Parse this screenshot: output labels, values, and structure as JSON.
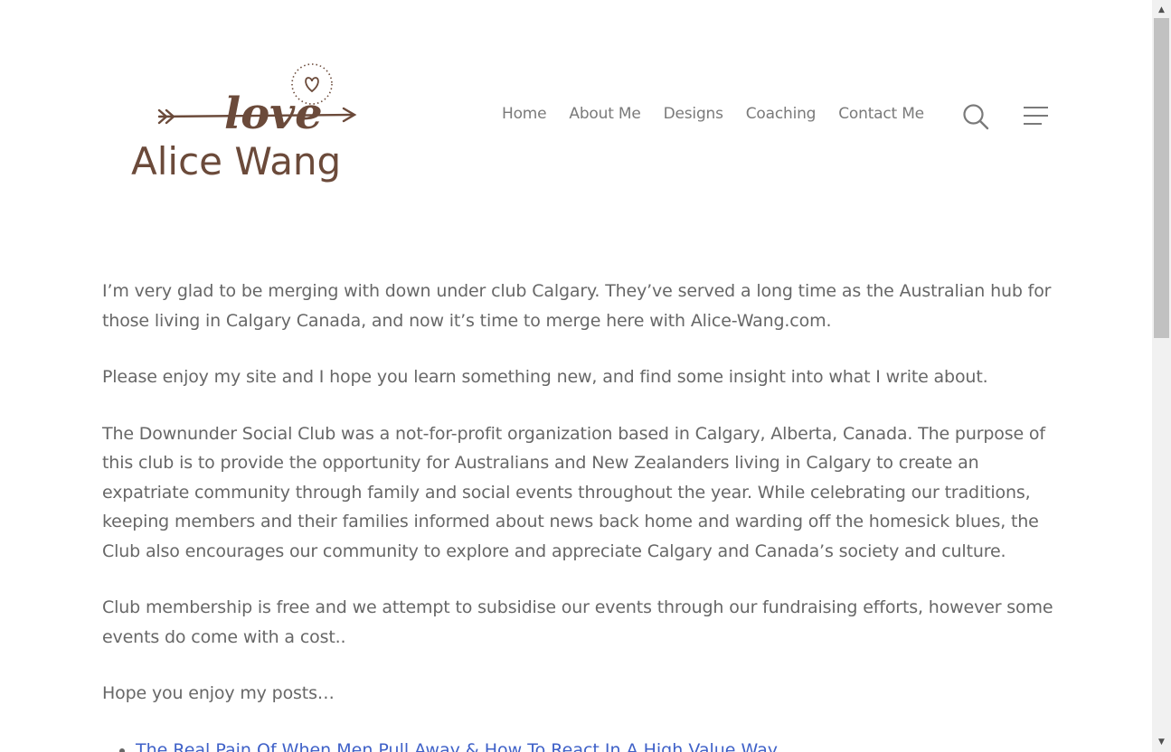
{
  "logo": {
    "script_word": "love",
    "brand_name": "Alice Wang"
  },
  "nav": {
    "items": [
      {
        "label": "Home"
      },
      {
        "label": "About Me"
      },
      {
        "label": "Designs"
      },
      {
        "label": "Coaching"
      },
      {
        "label": "Contact Me"
      }
    ],
    "search_icon": "search-icon",
    "menu_icon": "hamburger-menu-icon"
  },
  "content": {
    "paragraphs": [
      "I’m very glad to be merging with down under club Calgary. They’ve served a long time as the Australian hub for those living in Calgary Canada, and now it’s time to merge here with Alice-Wang.com.",
      "Please enjoy my site and I hope you learn something new, and find some insight into what I write about.",
      "The Downunder Social Club was a not-for-profit organization based in Calgary, Alberta, Canada. The purpose of this club is to provide the opportunity for Australians and New Zealanders living in Calgary to create an expatriate community through family and social events throughout the year. While celebrating our traditions, keeping members and their families informed about news back home and warding off the homesick blues, the Club also encourages our community to explore and appreciate Calgary and Canada’s society and culture.",
      "Club membership is free and we attempt to subsidise our events through our fundraising efforts, however some events do come with a cost..",
      "Hope you enjoy my posts…"
    ],
    "posts": [
      {
        "title": "The Real Pain Of When Men Pull Away & How To React In A High Value Way"
      }
    ]
  },
  "colors": {
    "logo_brown": "#6b4a3a",
    "nav_text": "#7a7a7a",
    "body_text": "#676767",
    "link": "#3f61c8",
    "scrollbar_track": "#f1f1f1",
    "scrollbar_thumb": "#c1c1c1"
  }
}
